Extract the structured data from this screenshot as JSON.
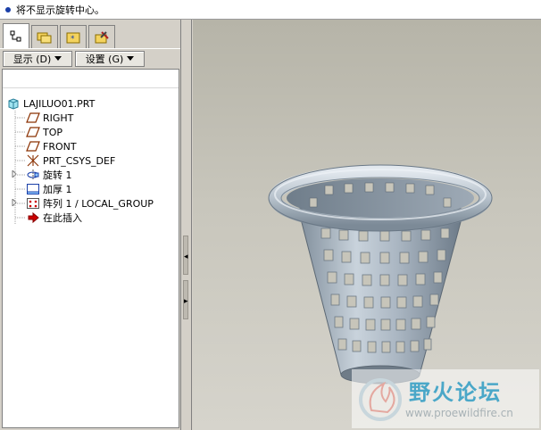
{
  "message_bar": {
    "text": "将不显示旋转中心。"
  },
  "toolbar": {
    "display_label": "显示 (D)",
    "settings_label": "设置 (G)"
  },
  "tabs": [
    {
      "icon": "model-tree-icon"
    },
    {
      "icon": "folder-browser-icon"
    },
    {
      "icon": "favorites-icon"
    },
    {
      "icon": "connections-icon"
    }
  ],
  "tree": {
    "root": "LAJILUO01.PRT",
    "items": [
      {
        "label": "RIGHT",
        "icon": "datum-plane-icon",
        "expandable": false
      },
      {
        "label": "TOP",
        "icon": "datum-plane-icon",
        "expandable": false
      },
      {
        "label": "FRONT",
        "icon": "datum-plane-icon",
        "expandable": false
      },
      {
        "label": "PRT_CSYS_DEF",
        "icon": "coordinate-system-icon",
        "expandable": false
      },
      {
        "label": "旋转 1",
        "icon": "revolve-icon",
        "expandable": true
      },
      {
        "label": "加厚 1",
        "icon": "thicken-icon",
        "expandable": false
      },
      {
        "label": "阵列 1 / LOCAL_GROUP",
        "icon": "pattern-icon",
        "expandable": true
      },
      {
        "label": "在此插入",
        "icon": "insert-here-icon",
        "expandable": false
      }
    ]
  },
  "watermark": {
    "title": "野火论坛",
    "url": "www.proewildfire.cn"
  },
  "colors": {
    "viewport_bg": "#c4c2b7",
    "model_fill": "#aab6c2",
    "watermark_blue": "#4aa7c8",
    "insert_arrow": "#cc0000"
  }
}
